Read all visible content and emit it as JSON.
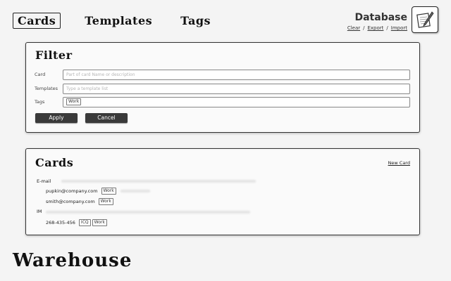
{
  "nav": {
    "tabs": [
      {
        "label": "Cards",
        "active": true
      },
      {
        "label": "Templates",
        "active": false
      },
      {
        "label": "Tags",
        "active": false
      }
    ]
  },
  "database": {
    "title": "Database",
    "links": {
      "clear": "Clear",
      "export": "Export",
      "import": "Import",
      "separator": "/"
    },
    "icon": "notebook-pencil-icon"
  },
  "filter": {
    "title": "Filter",
    "card_label": "Card",
    "card_placeholder": "Part of card Name or description",
    "templates_label": "Templates",
    "templates_placeholder": "Type a template list",
    "tags_label": "Tags",
    "tags_value": "Work",
    "apply_label": "Apply",
    "cancel_label": "Cancel"
  },
  "cards": {
    "title": "Cards",
    "new_card_label": "New Card",
    "groups": [
      {
        "label": "E-mail",
        "entries": [
          {
            "value": "pupkin@company.com",
            "tags": [
              "Work"
            ]
          },
          {
            "value": "smith@company.com",
            "tags": [
              "Work"
            ]
          }
        ]
      },
      {
        "label": "IM",
        "entries": [
          {
            "value": "268-435-456",
            "tags": [
              "ICQ",
              "Work"
            ]
          }
        ]
      }
    ]
  },
  "footer": {
    "brand": "Warehouse"
  },
  "colors": {
    "background": "#f4f4f4",
    "panel": "#fafafa",
    "button": "#3a3a3a",
    "border": "#333333"
  }
}
